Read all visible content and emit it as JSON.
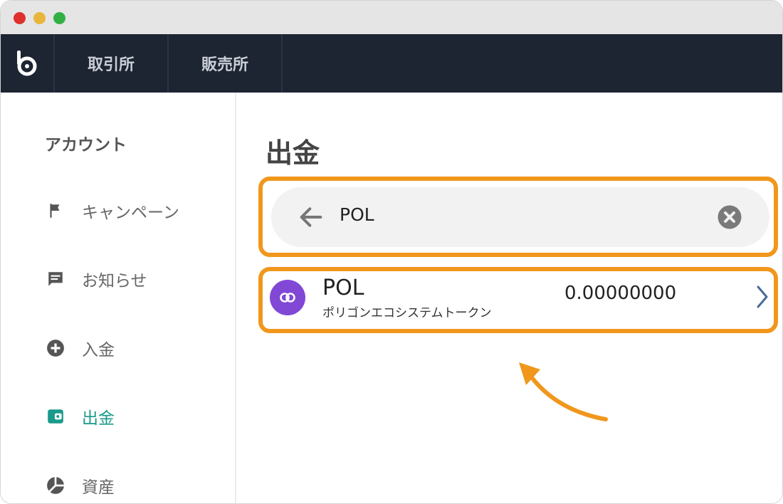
{
  "nav": {
    "logo_icon": "bitbank-logo-icon",
    "tabs": [
      {
        "label": "取引所"
      },
      {
        "label": "販売所"
      }
    ]
  },
  "sidebar": {
    "heading": "アカウント",
    "items": [
      {
        "label": "キャンペーン",
        "icon": "flag-icon",
        "active": false
      },
      {
        "label": "お知らせ",
        "icon": "message-icon",
        "active": false
      },
      {
        "label": "入金",
        "icon": "plus-circle-icon",
        "active": false
      },
      {
        "label": "出金",
        "icon": "wallet-icon",
        "active": true
      },
      {
        "label": "資産",
        "icon": "pie-chart-icon",
        "active": false
      }
    ]
  },
  "main": {
    "title": "出金",
    "search": {
      "value": "POL",
      "back_icon": "arrow-left-icon",
      "clear_icon": "clear-circle-icon"
    },
    "result": {
      "symbol": "POL",
      "name": "ポリゴンエコシステムトークン",
      "balance": "0.00000000",
      "icon": "polygon-coin-icon"
    }
  },
  "colors": {
    "nav_bg": "#1d2432",
    "highlight": "#f0971c",
    "active": "#1a9a8a",
    "coin": "#8148d6"
  }
}
